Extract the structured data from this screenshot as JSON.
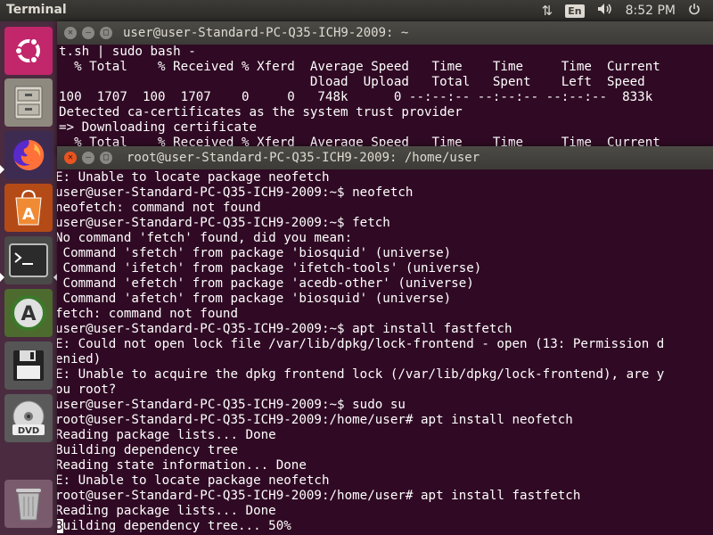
{
  "topbar": {
    "app_title": "Terminal",
    "lang": "En",
    "clock": "8:52 PM"
  },
  "launcher": {
    "items": [
      "ubuntu-logo-icon",
      "file-cabinet-icon",
      "firefox-icon",
      "software-center-icon",
      "terminal-icon",
      "software-updater-icon",
      "floppy-disk-icon",
      "dvd-icon",
      "trash-icon"
    ]
  },
  "window_back": {
    "title": "user@user-Standard-PC-Q35-ICH9-2009: ~",
    "lines": [
      "t.sh | sudo bash -",
      "  % Total    % Received % Xferd  Average Speed   Time    Time     Time  Current",
      "                                 Dload  Upload   Total   Spent    Left  Speed",
      "100  1707  100  1707    0     0   748k      0 --:--:-- --:--:-- --:--:--  833k",
      "Detected ca-certificates as the system trust provider",
      "=> Downloading certificate",
      "  % Total    % Received % Xferd  Average Speed   Time    Time     Time  Current"
    ]
  },
  "window_front": {
    "title": "root@user-Standard-PC-Q35-ICH9-2009: /home/user",
    "lines": [
      "E: Unable to locate package neofetch",
      "user@user-Standard-PC-Q35-ICH9-2009:~$ neofetch",
      "neofetch: command not found",
      "user@user-Standard-PC-Q35-ICH9-2009:~$ fetch",
      "No command 'fetch' found, did you mean:",
      " Command 'sfetch' from package 'biosquid' (universe)",
      " Command 'ifetch' from package 'ifetch-tools' (universe)",
      " Command 'efetch' from package 'acedb-other' (universe)",
      " Command 'afetch' from package 'biosquid' (universe)",
      "fetch: command not found",
      "user@user-Standard-PC-Q35-ICH9-2009:~$ apt install fastfetch",
      "E: Could not open lock file /var/lib/dpkg/lock-frontend - open (13: Permission d",
      "enied)",
      "E: Unable to acquire the dpkg frontend lock (/var/lib/dpkg/lock-frontend), are y",
      "ou root?",
      "user@user-Standard-PC-Q35-ICH9-2009:~$ sudo su",
      "root@user-Standard-PC-Q35-ICH9-2009:/home/user# apt install neofetch",
      "Reading package lists... Done",
      "Building dependency tree",
      "Reading state information... Done",
      "E: Unable to locate package neofetch",
      "root@user-Standard-PC-Q35-ICH9-2009:/home/user# apt install fastfetch",
      "Reading package lists... Done"
    ],
    "last_line_cursor": "B",
    "last_line_rest": "uilding dependency tree... 50%"
  }
}
